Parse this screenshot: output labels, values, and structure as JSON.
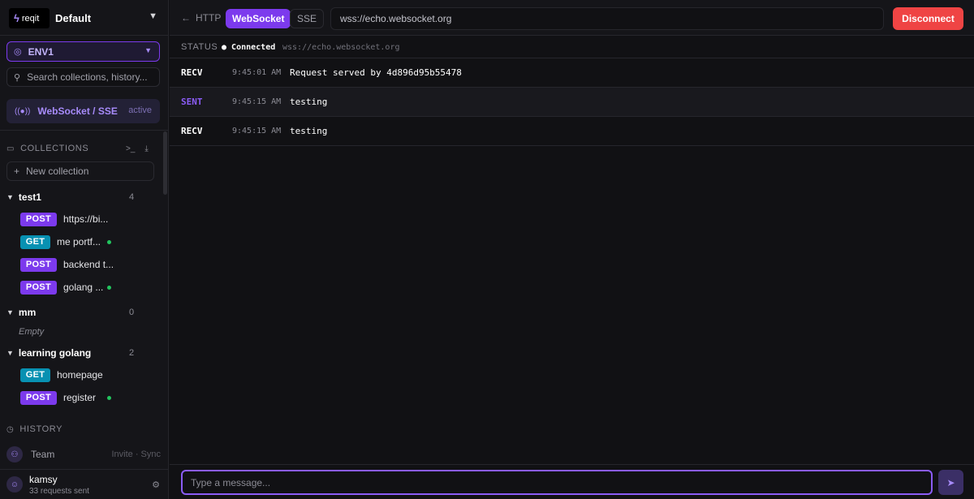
{
  "sidebar": {
    "logo_icon": "bolt-icon",
    "logo_text": "reqit",
    "workspace": "Default",
    "env": "ENV1",
    "search_placeholder": "Search collections, history...",
    "ws_item": {
      "label": "WebSocket / SSE",
      "badge": "active"
    },
    "collections_label": "COLLECTIONS",
    "new_collection": "New collection",
    "groups": [
      {
        "name": "test1",
        "count": "4",
        "requests": [
          {
            "method": "POST",
            "name": "https://bi...",
            "dot": false
          },
          {
            "method": "GET",
            "name": "me portf...",
            "dot": true
          },
          {
            "method": "POST",
            "name": "backend t...",
            "dot": false
          },
          {
            "method": "POST",
            "name": "golang ...",
            "dot": true
          }
        ]
      },
      {
        "name": "mm",
        "count": "0",
        "empty": "Empty"
      },
      {
        "name": "learning golang",
        "count": "2",
        "requests": [
          {
            "method": "GET",
            "name": "homepage",
            "dot": false
          },
          {
            "method": "POST",
            "name": "register",
            "dot": true
          }
        ]
      }
    ],
    "history_label": "HISTORY",
    "team": {
      "label": "Team",
      "side": "Invite · Sync"
    },
    "user": {
      "name": "kamsy",
      "sub": "33 requests sent"
    }
  },
  "topbar": {
    "back": "HTTP",
    "tab_ws": "WebSocket",
    "tab_sse": "SSE",
    "url": "wss://echo.websocket.org",
    "disconnect": "Disconnect"
  },
  "status": {
    "label": "STATUS",
    "state": "Connected",
    "url": "wss://echo.websocket.org"
  },
  "messages": [
    {
      "dir": "RECV",
      "time": "9:45:01 AM",
      "body": "Request served by 4d896d95b55478"
    },
    {
      "dir": "SENT",
      "time": "9:45:15 AM",
      "body": "testing"
    },
    {
      "dir": "RECV",
      "time": "9:45:15 AM",
      "body": "testing"
    }
  ],
  "composer": {
    "placeholder": "Type a message..."
  },
  "colors": {
    "accent": "#7c3aed",
    "danger": "#ef4444",
    "get": "#0891b2",
    "online": "#22c55e"
  }
}
